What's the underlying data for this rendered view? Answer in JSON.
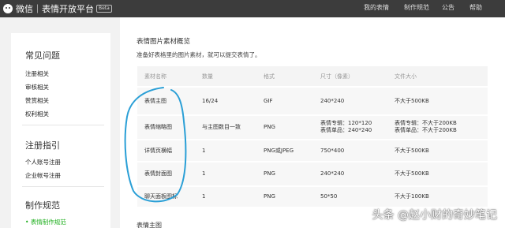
{
  "header": {
    "brand": "微信｜表情开放平台",
    "beta": "Beta",
    "nav": [
      "我的表情",
      "制作规范",
      "公告",
      "帮助"
    ]
  },
  "sidebar": {
    "sections": [
      {
        "title": "常见问题",
        "items": [
          "注册相关",
          "审核相关",
          "赞赏相关",
          "权利相关"
        ]
      },
      {
        "title": "注册指引",
        "items": [
          "个人账号注册",
          "企业帐号注册"
        ]
      },
      {
        "title": "制作规范",
        "items": [
          "• 表情制作规范"
        ]
      }
    ]
  },
  "main": {
    "title": "表情图片素材概览",
    "description": "准备好表格里的图片素材，就可以提交表情了。",
    "table": {
      "headers": [
        "素材名称",
        "数量",
        "格式",
        "尺寸（像素）",
        "文件大小"
      ],
      "rows": [
        [
          "表情主图",
          "16/24",
          "GIF",
          "240*240",
          "不大于500KB"
        ],
        [
          "表情缩略图",
          "与主图数目一致",
          "PNG",
          "表情专辑：120*120\n表情单品：240*240",
          "表情专辑：不大于200KB\n表情单品：不大于200KB"
        ],
        [
          "详情页横幅",
          "1",
          "PNG或JPEG",
          "750*400",
          "不大于500KB"
        ],
        [
          "表情封面图",
          "1",
          "PNG",
          "240*240",
          "不大于500KB"
        ],
        [
          "聊天面板图标",
          "1",
          "PNG",
          "50*50",
          "不大于100KB"
        ]
      ]
    },
    "subheading": "表情主图"
  },
  "watermark": "头条 @赵小财的奇妙笔记",
  "colors": {
    "topbar": "#3c3c3c",
    "accent": "#1aad19",
    "annotation": "#2a9fd6"
  }
}
